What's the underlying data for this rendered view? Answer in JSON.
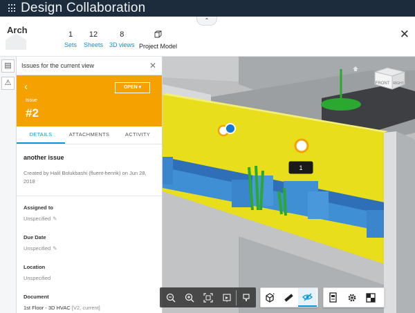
{
  "app": {
    "title": "Design Collaboration"
  },
  "project": {
    "name": "Arch",
    "stats": [
      {
        "count": "1",
        "label": "Sets"
      },
      {
        "count": "12",
        "label": "Sheets"
      },
      {
        "count": "8",
        "label": "3D views"
      },
      {
        "count": "",
        "label": "Project Model"
      }
    ]
  },
  "panel": {
    "header": "Issues for the current view",
    "status": "OPEN",
    "issue_label": "Issue",
    "issue_number": "#2",
    "tabs": [
      "DETAILS",
      "ATTACHMENTS",
      "ACTIVITY"
    ],
    "issue_title": "another issue",
    "created_by": "Created by Halil Bolukbashi (fluent-henrik) on Jun 28, 2018",
    "fields": [
      {
        "label": "Assigned to",
        "value": "Unspecified",
        "editable": true
      },
      {
        "label": "Due Date",
        "value": "Unspecified",
        "editable": true
      },
      {
        "label": "Location",
        "value": "Unspecified",
        "editable": false
      },
      {
        "label": "Document",
        "value": "1st Floor - 3D HVAC",
        "suffix": "[V2, current]",
        "editable": false
      }
    ]
  },
  "viewer": {
    "cube_front": "FRONT",
    "cube_right": "RIGHT",
    "pin_label": "1",
    "colors": {
      "wall": "#e8de1c",
      "duct": "#3f8fd4",
      "pin_orange": "#f5a200",
      "pin_blue": "#1478d4",
      "floor": "#c6c8ca"
    }
  },
  "toolbar": {
    "icons": [
      "zoom-out-icon",
      "zoom-in-icon",
      "fit-to-view-icon",
      "fullscreen-icon",
      "markup-icon",
      "model-browser-icon",
      "measure-icon",
      "section-icon",
      "properties-icon",
      "settings-icon",
      "explode-icon"
    ]
  }
}
